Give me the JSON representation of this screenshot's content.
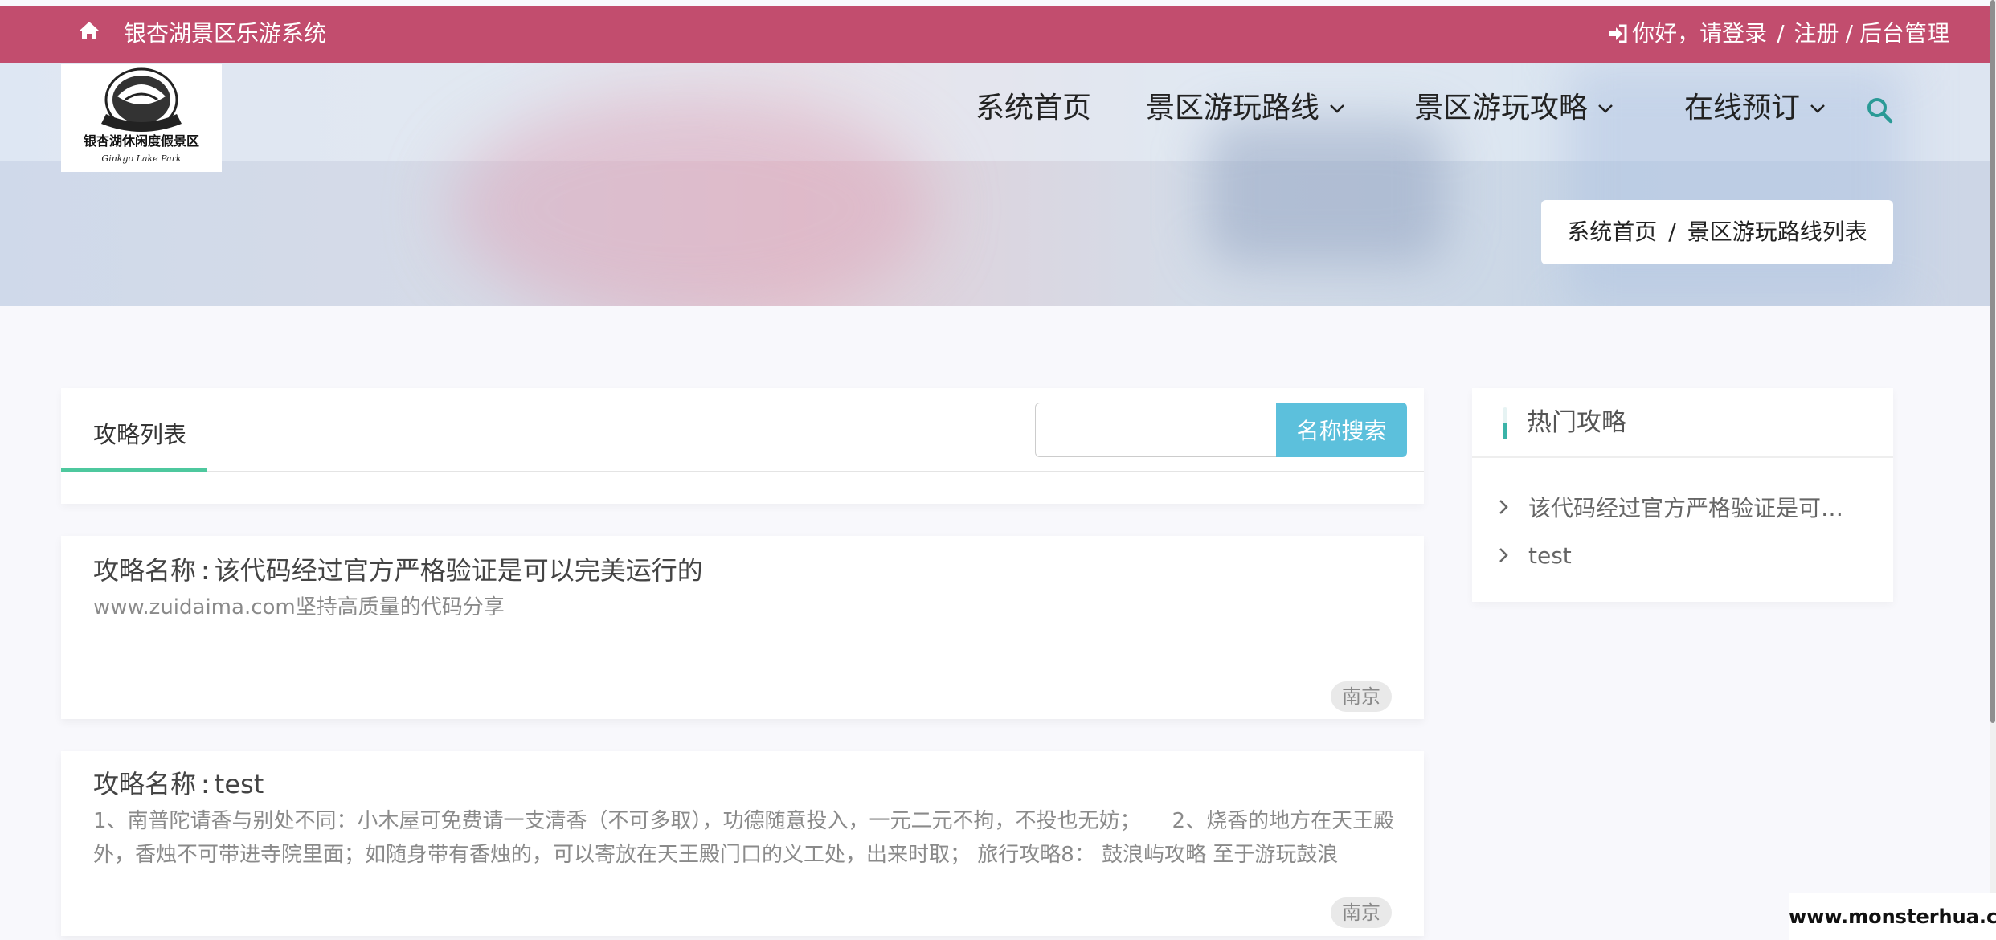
{
  "topbar": {
    "site_name": "银杏湖景区乐游系统",
    "greeting": "你好，请登录",
    "sep": "/",
    "register": "注册",
    "admin": "后台管理"
  },
  "nav": {
    "home": "系统首页",
    "routes": "景区游玩路线",
    "guides": "景区游玩攻略",
    "booking": "在线预订"
  },
  "breadcrumb": {
    "home": "系统首页",
    "sep": "/",
    "current": "景区游玩路线列表"
  },
  "list": {
    "tab": "攻略列表",
    "search_button": "名称搜索",
    "search_value": "",
    "items": [
      {
        "label": "攻略名称",
        "colon": ":",
        "name": "该代码经过官方严格验证是可以完美运行的",
        "desc": "www.zuidaima.com坚持高质量的代码分享",
        "tag": "南京"
      },
      {
        "label": "攻略名称",
        "colon": ":",
        "name": "test",
        "desc": "1、南普陀请香与别处不同：小木屋可免费请一支清香（不可多取），功德随意投入，一元二元不拘，不投也无妨；　　2、烧香的地方在天王殿外，香烛不可带进寺院里面；如随身带有香烛的，可以寄放在天王殿门口的义工处，出来时取； 旅行攻略8： 鼓浪屿攻略 至于游玩鼓浪",
        "tag": "南京"
      }
    ]
  },
  "sidebar": {
    "title": "热门攻略",
    "items": [
      "该代码经过官方严格验证是可以完美运行的",
      "test"
    ]
  },
  "watermark": "www.monsterhua.com",
  "colors": {
    "topbar": "#c24d6e",
    "accent_green": "#4ec89e",
    "search_button": "#5cc0dc",
    "search_icon": "#2a9a96"
  }
}
